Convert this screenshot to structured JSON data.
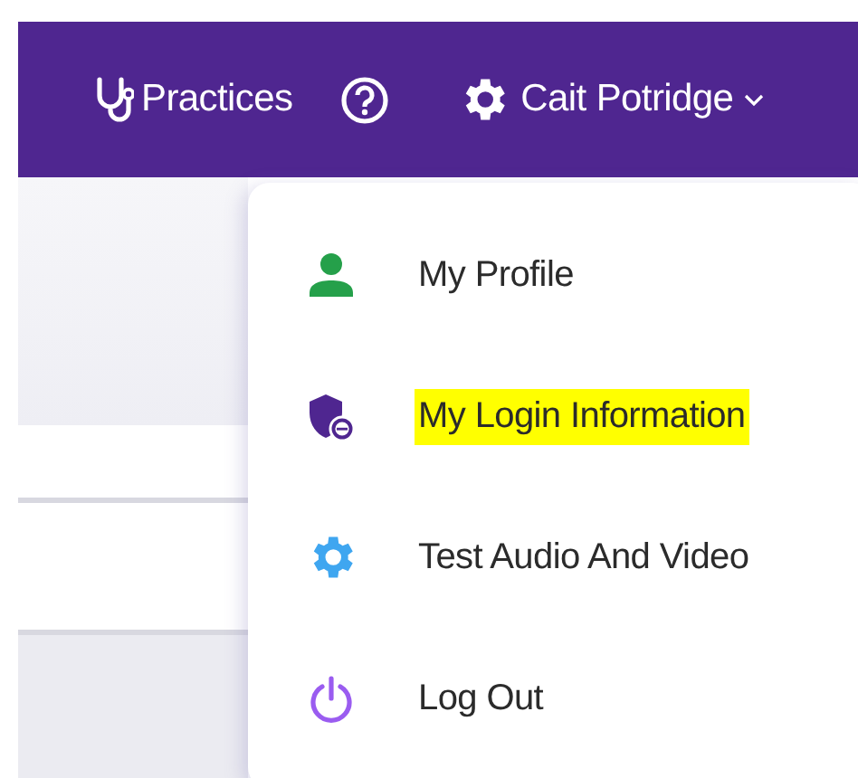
{
  "header": {
    "nav": [
      {
        "kind": "practices",
        "label": "Practices"
      },
      {
        "kind": "help"
      },
      {
        "kind": "user",
        "label": "Cait Potridge",
        "expanded": true
      }
    ]
  },
  "user_menu": {
    "items": [
      {
        "kind": "profile",
        "label": "My Profile",
        "highlighted": false
      },
      {
        "kind": "login",
        "label": "My Login Information",
        "highlighted": true
      },
      {
        "kind": "settings",
        "label": "Test Audio And Video",
        "highlighted": false
      },
      {
        "kind": "logout",
        "label": "Log Out",
        "highlighted": false
      }
    ]
  }
}
